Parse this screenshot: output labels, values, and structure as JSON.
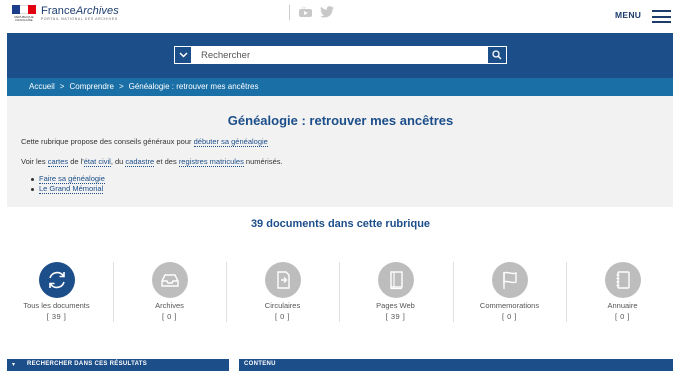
{
  "header": {
    "brand_name": "France",
    "brand_name_italic": "Archives",
    "brand_subtitle": "PORTAIL NATIONAL DES ARCHIVES",
    "republic_text": "RÉPUBLIQUE FRANÇAISE",
    "menu_label": "MENU",
    "flag_colors": [
      "#1c3c8c",
      "#ffffff",
      "#e1000f"
    ]
  },
  "search": {
    "placeholder": "Rechercher"
  },
  "breadcrumb": {
    "items": [
      "Accueil",
      "Comprendre",
      "Généalogie : retrouver mes ancêtres"
    ],
    "separator": ">"
  },
  "intro": {
    "title": "Généalogie : retrouver mes ancêtres",
    "line1_prefix": "Cette rubrique propose des conseils généraux pour ",
    "line1_link": "débuter sa généalogie",
    "line2_parts": [
      "Voir les ",
      "cartes",
      " de l'",
      "état civil",
      ", du ",
      "cadastre",
      " et des ",
      "registres matricules",
      " numérisés."
    ],
    "links": [
      "Faire sa généalogie",
      "Le Grand Mémorial"
    ]
  },
  "results": {
    "count_text": "39 documents dans cette rubrique"
  },
  "categories": [
    {
      "label": "Tous les documents",
      "count": "[ 39 ]",
      "icon": "refresh-icon",
      "active": true
    },
    {
      "label": "Archives",
      "count": "[ 0 ]",
      "icon": "inbox-tray-icon",
      "active": false
    },
    {
      "label": "Circulaires",
      "count": "[ 0 ]",
      "icon": "document-export-icon",
      "active": false
    },
    {
      "label": "Pages Web",
      "count": "[ 39 ]",
      "icon": "book-icon",
      "active": false
    },
    {
      "label": "Commemorations",
      "count": "[ 0 ]",
      "icon": "flag-icon",
      "active": false
    },
    {
      "label": "Annuaire",
      "count": "[ 0 ]",
      "icon": "address-book-icon",
      "active": false
    }
  ],
  "panels": {
    "left_title": "RECHERCHER DANS CES RÉSULTATS",
    "right_title": "CONTENU"
  },
  "colors": {
    "primary": "#1c4e8a",
    "breadcrumb_bg": "#1a6fa6",
    "intro_bg": "#f2f2f2",
    "icon_inactive": "#bdbdbd"
  }
}
